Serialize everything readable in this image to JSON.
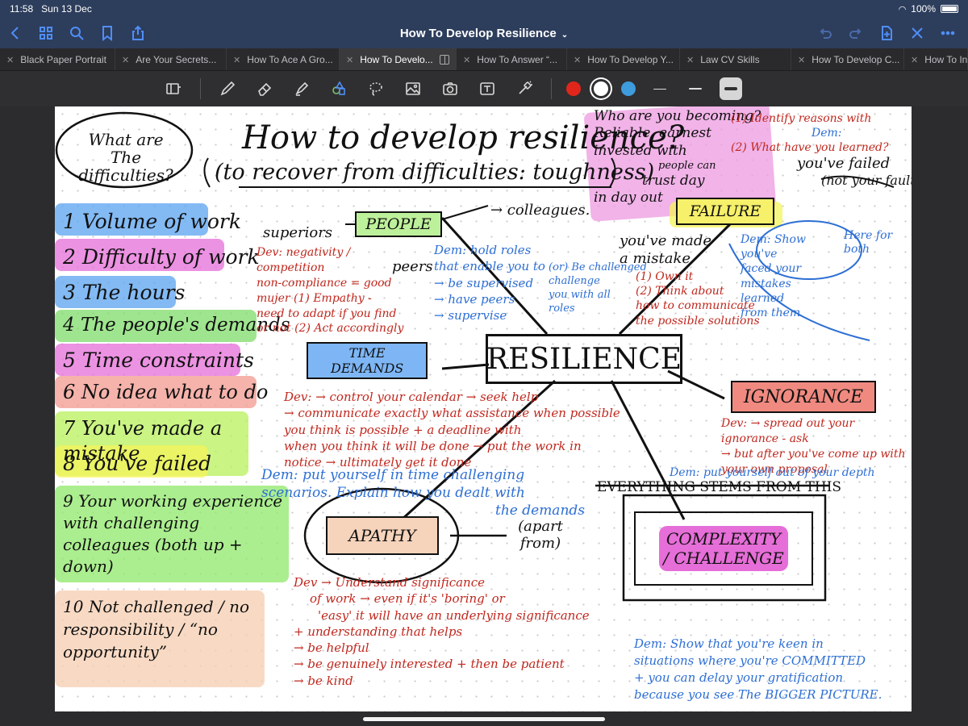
{
  "status": {
    "time": "11:58",
    "date": "Sun 13 Dec",
    "battery": "100%"
  },
  "nav": {
    "title": "How To Develop Resilience",
    "chevron": "⌄"
  },
  "tabs": [
    {
      "label": "Black Paper Portrait",
      "active": false
    },
    {
      "label": "Are Your Secrets...",
      "active": false
    },
    {
      "label": "How To Ace A Gro...",
      "active": false
    },
    {
      "label": "How To Develo...",
      "active": true
    },
    {
      "label": "How To Answer “...",
      "active": false
    },
    {
      "label": "How To Develop Y...",
      "active": false
    },
    {
      "label": "Law CV Skills",
      "active": false
    },
    {
      "label": "How To Develop C...",
      "active": false
    },
    {
      "label": "How To In",
      "active": false
    }
  ],
  "toolbar": {
    "colors": [
      "#e0261b",
      "#ffffff",
      "#3e9bdc"
    ],
    "selected_color": "#ffffff"
  },
  "note": {
    "bubble": "What are The difficulties?",
    "title": "How to develop resilience?",
    "subtitle": "(to recover from difficulties: toughness)",
    "list": [
      {
        "n": "1",
        "text": "Volume of work"
      },
      {
        "n": "2",
        "text": "Difficulty of work"
      },
      {
        "n": "3",
        "text": "The hours"
      },
      {
        "n": "4",
        "text": "The people's demands"
      },
      {
        "n": "5",
        "text": "Time constraints"
      },
      {
        "n": "6",
        "text": "No idea what to do"
      },
      {
        "n": "7",
        "text": "You've made a mistake"
      },
      {
        "n": "8",
        "text": "You've failed"
      },
      {
        "n": "9",
        "text": "Your working experience with challenging colleagues (both up + down)"
      },
      {
        "n": "10",
        "text": "Not challenged / no responsibility / “no opportunity”"
      }
    ],
    "center": "RESILIENCE",
    "nodes": {
      "people": "PEOPLE",
      "failure": "FAILURE",
      "time": "TIME DEMANDS",
      "ignorance": "IGNORANCE",
      "apathy": "APATHY",
      "complexity": "COMPLEXITY / CHALLENGE"
    },
    "people_side": {
      "superiors": "superiors",
      "colleagues": "→ colleagues.",
      "peers": "peers"
    },
    "people_red": [
      "Dev: negativity /",
      "competition",
      "non-compliance = good",
      "mujer (1) Empathy -",
      "need to adapt if you find",
      "or not (2) Act accordingly"
    ],
    "people_blue": [
      "Dem: hold roles",
      "that enable you to",
      "→ be supervised",
      "→ have peers",
      "→ supervise"
    ],
    "people_blue2": [
      "(or) Be challenged",
      "challenge",
      "you with all",
      "roles"
    ],
    "pink_top": [
      "Who are you becoming?",
      "Reliable, earnest",
      "invested with",
      "people can",
      "trust day",
      "in day out"
    ],
    "failure_top": [
      "(1) Identify reasons with",
      "Dem:",
      "(2) What have you learned?",
      "you've failed",
      "(not your fault)"
    ],
    "mistake": [
      "you've made",
      "a mistake",
      "(1) Own it",
      "(2) Think about",
      "how to communicate",
      "the possible solutions"
    ],
    "failure_blue": [
      "Dem: Show",
      "you've",
      "faced your",
      "mistakes",
      "learned",
      "from them",
      "Here for",
      "both"
    ],
    "time_red": [
      "Dev: → control your calendar → seek help",
      "→ communicate exactly what assistance when possible",
      "you think is possible + a deadline with",
      "when you think it will be done → put the work in",
      "notice → ultimately get it done"
    ],
    "time_blue": [
      "Dem: put yourself in time challenging",
      "scenarios. Explain how you dealt with",
      "the demands"
    ],
    "ignorance_red": [
      "Dev: → spread out your",
      "ignorance - ask",
      "→ but after you've come up with",
      "your own proposal"
    ],
    "ignorance_blue": [
      "Dem: put yourself out of your depth"
    ],
    "everything": "EVERYTHING STEMS FROM THIS",
    "apart": "(apart from)",
    "apathy_red": [
      "Dev → Understand significance",
      "of work → even if it's 'boring' or",
      "'easy' it will have an underlying significance",
      "+ understanding that helps",
      "→ be helpful",
      "→ be genuinely interested + then be patient",
      "→ be kind"
    ],
    "bottom_blue": [
      "Dem: Show that you're keen in",
      "situations where you're COMMITTED",
      "+ you can delay your gratification",
      "because you see The BIGGER PICTURE."
    ]
  }
}
